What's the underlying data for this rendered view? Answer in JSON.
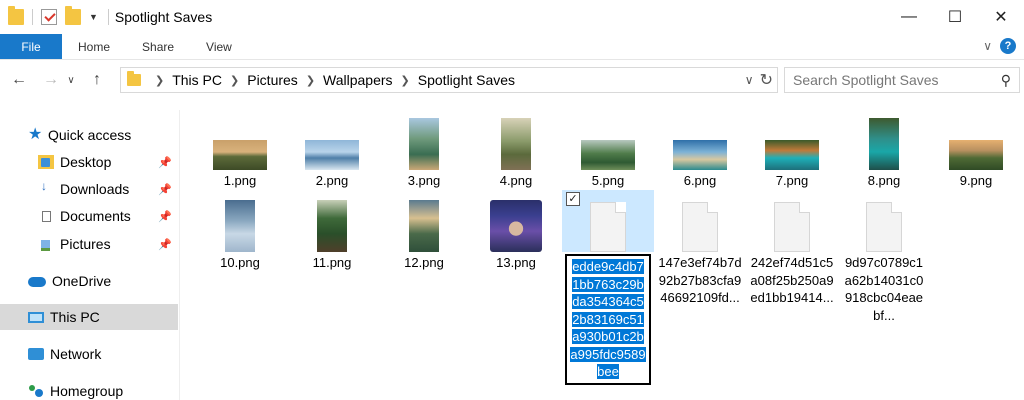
{
  "window": {
    "title": "Spotlight Saves",
    "controls": [
      "minimize",
      "maximize",
      "close"
    ]
  },
  "ribbon": {
    "tabs": [
      "File",
      "Home",
      "Share",
      "View"
    ]
  },
  "address": {
    "crumbs": [
      "This PC",
      "Pictures",
      "Wallpapers",
      "Spotlight Saves"
    ]
  },
  "search": {
    "placeholder": "Search Spotlight Saves"
  },
  "sidebar": {
    "items": [
      {
        "label": "Quick access",
        "icon": "star-icon"
      },
      {
        "label": "Desktop",
        "icon": "desktop-folder-icon",
        "pinned": true
      },
      {
        "label": "Downloads",
        "icon": "downloads-folder-icon",
        "pinned": true
      },
      {
        "label": "Documents",
        "icon": "documents-folder-icon",
        "pinned": true
      },
      {
        "label": "Pictures",
        "icon": "pictures-folder-icon",
        "pinned": true
      },
      {
        "label": "OneDrive",
        "icon": "cloud-icon"
      },
      {
        "label": "This PC",
        "icon": "computer-icon",
        "selected": true
      },
      {
        "label": "Network",
        "icon": "network-icon"
      },
      {
        "label": "Homegroup",
        "icon": "homegroup-icon"
      }
    ]
  },
  "files": [
    {
      "name": "1.png"
    },
    {
      "name": "2.png"
    },
    {
      "name": "3.png"
    },
    {
      "name": "4.png"
    },
    {
      "name": "5.png"
    },
    {
      "name": "6.png"
    },
    {
      "name": "7.png"
    },
    {
      "name": "8.png"
    },
    {
      "name": "9.png"
    },
    {
      "name": "10.png"
    },
    {
      "name": "11.png"
    },
    {
      "name": "12.png"
    },
    {
      "name": "13.png"
    },
    {
      "name": "edde9c4db71bb763c29bda354364c52b83169c51a930b01c2ba995fdc9589bee",
      "selected": true,
      "renaming": true
    },
    {
      "name": "147e3ef74b7d92b27b83cfa946692109fd..."
    },
    {
      "name": "242ef74d51c5a08f25b250a9ed1bb19414..."
    },
    {
      "name": "9d97c0789c1a62b14031c0918cbc04eaebf..."
    }
  ],
  "colors": {
    "accent": "#1979ca",
    "selection": "#cce8ff",
    "rename_highlight": "#0078d7"
  }
}
